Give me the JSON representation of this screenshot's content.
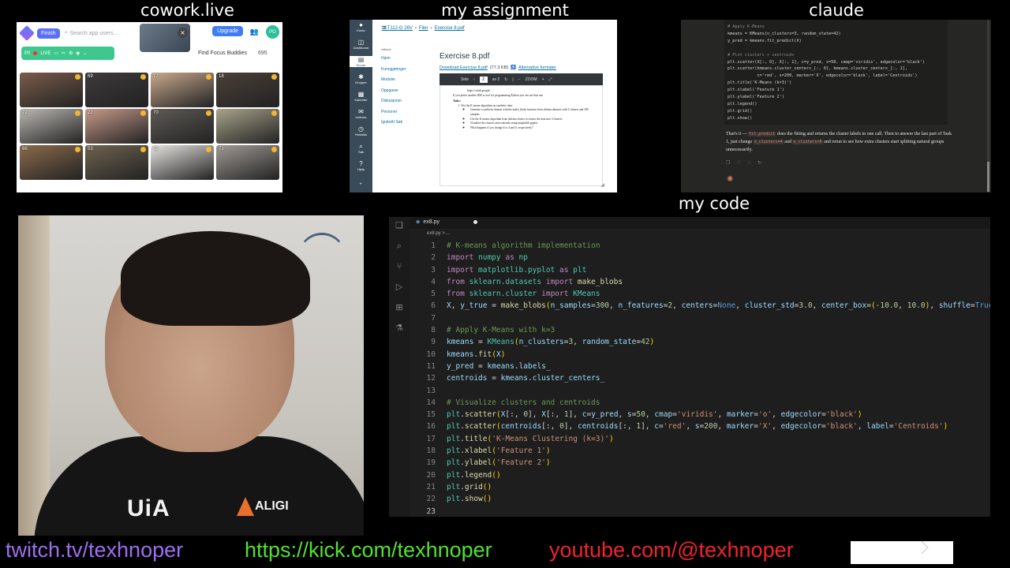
{
  "titles": {
    "cowork": "cowork.live",
    "assignment": "my assignment",
    "claude": "claude",
    "code": "my code"
  },
  "cowork": {
    "finish_label": "Finish",
    "search_placeholder": "Search app users...",
    "upgrade_label": "Upgrade",
    "avatar_initials": "PO",
    "live_label": "LIVE",
    "find_buddies": "Find Focus Buddies",
    "buddy_count": "695",
    "tiles": [
      {
        "badge": "",
        "color": "#7a5c4a"
      },
      {
        "badge": "69",
        "color": "#3d3a3a"
      },
      {
        "badge": "77",
        "color": "#c9a98e"
      },
      {
        "badge": "18",
        "color": "#4a4038"
      },
      {
        "badge": "72",
        "color": "#bcb8b2"
      },
      {
        "badge": "22",
        "color": "#c79a8a"
      },
      {
        "badge": "70",
        "color": "#5e5a55"
      },
      {
        "badge": "",
        "color": "#a8a38a"
      },
      {
        "badge": "66",
        "color": "#8b6b4d"
      },
      {
        "badge": "53",
        "color": "#6e6350"
      },
      {
        "badge": "52",
        "color": "#e6e4e0"
      },
      {
        "badge": "71",
        "color": "#a09a94"
      }
    ]
  },
  "assignment": {
    "nav": [
      "Konto",
      "Dashboard",
      "Emner",
      "Grupper",
      "Kalender",
      "Innboks",
      "Historikk",
      "Søk",
      "Hjelp"
    ],
    "breadcrumb": [
      "IKT112-G 26V",
      "Filer",
      "Exercise 8.pdf"
    ],
    "course_nav": [
      "Hjem",
      "Kunngjøringer",
      "Moduler",
      "Oppgaver",
      "Diskusjoner",
      "Personer",
      "IgniteAI Søk"
    ],
    "course_nav_top": "ståside",
    "title": "Exercise 8.pdf",
    "download_link": "Download Exercise 8.pdf",
    "file_size": "(77.3 KB)",
    "alt_formats": "Alternative formater",
    "toolbar": {
      "side": "Side",
      "page": "2",
      "of": "av 2",
      "zoom": "ZOOM"
    },
    "pdf_url": "https://colab.google/",
    "pdf_intro": "If you prefer another IDE or tool for programming Python you can use that one.",
    "pdf_tasks_heading": "Tasks:",
    "pdf_task1": "Test the K means algorithm on synthetic data:",
    "pdf_bullets": [
      "Generate a synthetic dataset with the make_blobs function from sklearn.datasets with 3 clusters and 300 samples.",
      "Use the K means algorithm from sklearn.cluster to cluster the data into 3 clusters.",
      "Visualize the clusters and centroids using matplotlib.pyplot.",
      "What happens if you change k to 4 and 6, respectively?"
    ]
  },
  "claude": {
    "code_lines": [
      "# Apply K-Means",
      "kmeans = KMeans(n_clusters=3, random_state=42)",
      "y_pred = kmeans.fit_predict(X)",
      "",
      "# Plot clusters + centroids",
      "plt.scatter(X[:, 0], X[:, 1], c=y_pred, s=50, cmap='viridis', edgecolor='black')",
      "plt.scatter(kmeans.cluster_centers_[:, 0], kmeans.cluster_centers_[:, 1],",
      "            c='red', s=200, marker='X', edgecolor='black', label='Centroids')",
      "plt.title('K-Means (k=3)')",
      "plt.xlabel('Feature 1')",
      "plt.ylabel('Feature 2')",
      "plt.legend()",
      "plt.grid()",
      "plt.show()"
    ],
    "reply_1": "That's it —",
    "reply_code1": "fit_predict",
    "reply_2": "does the fitting and returns the cluster labels in one call. Then to answer the last part of Task 1, just change",
    "reply_code2": "n_clusters=4",
    "reply_3": "and",
    "reply_code3": "n_clusters=6",
    "reply_4": "and rerun to see how extra clusters start splitting natural groups unnecessarily."
  },
  "editor": {
    "tab_name": "ex8.py",
    "breadcrumb": "ex8.py > ..."
  },
  "code_lines": [
    [
      [
        "k-com",
        "# K-means algorithm implementation"
      ]
    ],
    [
      [
        "k-kw",
        "import "
      ],
      [
        "k-cls",
        "numpy"
      ],
      [
        "k-kw",
        " as "
      ],
      [
        "k-cls",
        "np"
      ]
    ],
    [
      [
        "k-kw",
        "import "
      ],
      [
        "k-cls",
        "matplotlib.pyplot"
      ],
      [
        "k-kw",
        " as "
      ],
      [
        "k-cls",
        "plt"
      ]
    ],
    [
      [
        "k-kw",
        "from "
      ],
      [
        "k-cls",
        "sklearn.datasets"
      ],
      [
        "k-kw",
        " import "
      ],
      [
        "k-fn",
        "make_blobs"
      ]
    ],
    [
      [
        "k-kw",
        "from "
      ],
      [
        "k-cls",
        "sklearn.cluster"
      ],
      [
        "k-kw",
        " import "
      ],
      [
        "k-cls",
        "KMeans"
      ]
    ],
    [
      [
        "k-var",
        "X"
      ],
      [
        "k-pun",
        ", "
      ],
      [
        "k-var",
        "y_true"
      ],
      [
        "k-pun",
        " = "
      ],
      [
        "k-fn",
        "make_blobs"
      ],
      [
        "k-yel",
        "("
      ],
      [
        "k-var",
        "n_samples"
      ],
      [
        "k-pun",
        "="
      ],
      [
        "k-num",
        "300"
      ],
      [
        "k-pun",
        ", "
      ],
      [
        "k-var",
        "n_features"
      ],
      [
        "k-pun",
        "="
      ],
      [
        "k-num",
        "2"
      ],
      [
        "k-pun",
        ", "
      ],
      [
        "k-var",
        "centers"
      ],
      [
        "k-pun",
        "="
      ],
      [
        "k-cst",
        "None"
      ],
      [
        "k-pun",
        ", "
      ],
      [
        "k-var",
        "cluster_std"
      ],
      [
        "k-pun",
        "="
      ],
      [
        "k-num",
        "3.0"
      ],
      [
        "k-pun",
        ", "
      ],
      [
        "k-var",
        "center_box"
      ],
      [
        "k-pun",
        "="
      ],
      [
        "k-yel",
        "("
      ],
      [
        "k-num",
        "-10.0"
      ],
      [
        "k-pun",
        ", "
      ],
      [
        "k-num",
        "10.0"
      ],
      [
        "k-yel",
        ")"
      ],
      [
        "k-pun",
        ", "
      ],
      [
        "k-var",
        "shuffle"
      ],
      [
        "k-pun",
        "="
      ],
      [
        "k-cst",
        "True"
      ],
      [
        "k-pun",
        ", "
      ]
    ],
    [],
    [
      [
        "k-com",
        "# Apply K-Means with k=3"
      ]
    ],
    [
      [
        "k-var",
        "kmeans"
      ],
      [
        "k-pun",
        " = "
      ],
      [
        "k-cls",
        "KMeans"
      ],
      [
        "k-yel",
        "("
      ],
      [
        "k-var",
        "n_clusters"
      ],
      [
        "k-pun",
        "="
      ],
      [
        "k-num",
        "3"
      ],
      [
        "k-pun",
        ", "
      ],
      [
        "k-var",
        "random_state"
      ],
      [
        "k-pun",
        "="
      ],
      [
        "k-num",
        "42"
      ],
      [
        "k-yel",
        ")"
      ]
    ],
    [
      [
        "k-var",
        "kmeans"
      ],
      [
        "k-pun",
        "."
      ],
      [
        "k-fn",
        "fit"
      ],
      [
        "k-yel",
        "("
      ],
      [
        "k-var",
        "X"
      ],
      [
        "k-yel",
        ")"
      ]
    ],
    [
      [
        "k-var",
        "y_pred"
      ],
      [
        "k-pun",
        " = "
      ],
      [
        "k-var",
        "kmeans"
      ],
      [
        "k-pun",
        "."
      ],
      [
        "k-var",
        "labels_"
      ]
    ],
    [
      [
        "k-var",
        "centroids"
      ],
      [
        "k-pun",
        " = "
      ],
      [
        "k-var",
        "kmeans"
      ],
      [
        "k-pun",
        "."
      ],
      [
        "k-var",
        "cluster_centers_"
      ]
    ],
    [],
    [
      [
        "k-com",
        "# Visualize clusters and centroids"
      ]
    ],
    [
      [
        "k-cls",
        "plt"
      ],
      [
        "k-pun",
        "."
      ],
      [
        "k-fn",
        "scatter"
      ],
      [
        "k-yel",
        "("
      ],
      [
        "k-var",
        "X"
      ],
      [
        "k-pun",
        "[:, "
      ],
      [
        "k-num",
        "0"
      ],
      [
        "k-pun",
        "], "
      ],
      [
        "k-var",
        "X"
      ],
      [
        "k-pun",
        "[:, "
      ],
      [
        "k-num",
        "1"
      ],
      [
        "k-pun",
        "], "
      ],
      [
        "k-var",
        "c"
      ],
      [
        "k-pun",
        "="
      ],
      [
        "k-var",
        "y_pred"
      ],
      [
        "k-pun",
        ", "
      ],
      [
        "k-var",
        "s"
      ],
      [
        "k-pun",
        "="
      ],
      [
        "k-num",
        "50"
      ],
      [
        "k-pun",
        ", "
      ],
      [
        "k-var",
        "cmap"
      ],
      [
        "k-pun",
        "="
      ],
      [
        "k-str",
        "'viridis'"
      ],
      [
        "k-pun",
        ", "
      ],
      [
        "k-var",
        "marker"
      ],
      [
        "k-pun",
        "="
      ],
      [
        "k-str",
        "'o'"
      ],
      [
        "k-pun",
        ", "
      ],
      [
        "k-var",
        "edgecolor"
      ],
      [
        "k-pun",
        "="
      ],
      [
        "k-str",
        "'black'"
      ],
      [
        "k-yel",
        ")"
      ]
    ],
    [
      [
        "k-cls",
        "plt"
      ],
      [
        "k-pun",
        "."
      ],
      [
        "k-fn",
        "scatter"
      ],
      [
        "k-yel",
        "("
      ],
      [
        "k-var",
        "centroids"
      ],
      [
        "k-pun",
        "[:, "
      ],
      [
        "k-num",
        "0"
      ],
      [
        "k-pun",
        "], "
      ],
      [
        "k-var",
        "centroids"
      ],
      [
        "k-pun",
        "[:, "
      ],
      [
        "k-num",
        "1"
      ],
      [
        "k-pun",
        "], "
      ],
      [
        "k-var",
        "c"
      ],
      [
        "k-pun",
        "="
      ],
      [
        "k-str",
        "'red'"
      ],
      [
        "k-pun",
        ", "
      ],
      [
        "k-var",
        "s"
      ],
      [
        "k-pun",
        "="
      ],
      [
        "k-num",
        "200"
      ],
      [
        "k-pun",
        ", "
      ],
      [
        "k-var",
        "marker"
      ],
      [
        "k-pun",
        "="
      ],
      [
        "k-str",
        "'X'"
      ],
      [
        "k-pun",
        ", "
      ],
      [
        "k-var",
        "edgecolor"
      ],
      [
        "k-pun",
        "="
      ],
      [
        "k-str",
        "'black'"
      ],
      [
        "k-pun",
        ", "
      ],
      [
        "k-var",
        "label"
      ],
      [
        "k-pun",
        "="
      ],
      [
        "k-str",
        "'Centroids'"
      ],
      [
        "k-yel",
        ")"
      ]
    ],
    [
      [
        "k-cls",
        "plt"
      ],
      [
        "k-pun",
        "."
      ],
      [
        "k-fn",
        "title"
      ],
      [
        "k-yel",
        "("
      ],
      [
        "k-str",
        "'K-Means Clustering (k=3)'"
      ],
      [
        "k-yel",
        ")"
      ]
    ],
    [
      [
        "k-cls",
        "plt"
      ],
      [
        "k-pun",
        "."
      ],
      [
        "k-fn",
        "xlabel"
      ],
      [
        "k-yel",
        "("
      ],
      [
        "k-str",
        "'Feature 1'"
      ],
      [
        "k-yel",
        ")"
      ]
    ],
    [
      [
        "k-cls",
        "plt"
      ],
      [
        "k-pun",
        "."
      ],
      [
        "k-fn",
        "ylabel"
      ],
      [
        "k-yel",
        "("
      ],
      [
        "k-str",
        "'Feature 2'"
      ],
      [
        "k-yel",
        ")"
      ]
    ],
    [
      [
        "k-cls",
        "plt"
      ],
      [
        "k-pun",
        "."
      ],
      [
        "k-fn",
        "legend"
      ],
      [
        "k-yel",
        "()"
      ]
    ],
    [
      [
        "k-cls",
        "plt"
      ],
      [
        "k-pun",
        "."
      ],
      [
        "k-fn",
        "grid"
      ],
      [
        "k-yel",
        "()"
      ]
    ],
    [
      [
        "k-cls",
        "plt"
      ],
      [
        "k-pun",
        "."
      ],
      [
        "k-fn",
        "show"
      ],
      [
        "k-yel",
        "()"
      ]
    ],
    []
  ],
  "webcam": {
    "shirt_logo": "UiA",
    "shirt_logo2": "ALIGI"
  },
  "footer": {
    "twitch": "twitch.tv/texhnoper",
    "kick": "https://kick.com/texhnoper",
    "youtube": "youtube.com/@texhnoper",
    "twitch_color": "#a06df0",
    "kick_color": "#52e032",
    "youtube_color": "#f0232d"
  }
}
